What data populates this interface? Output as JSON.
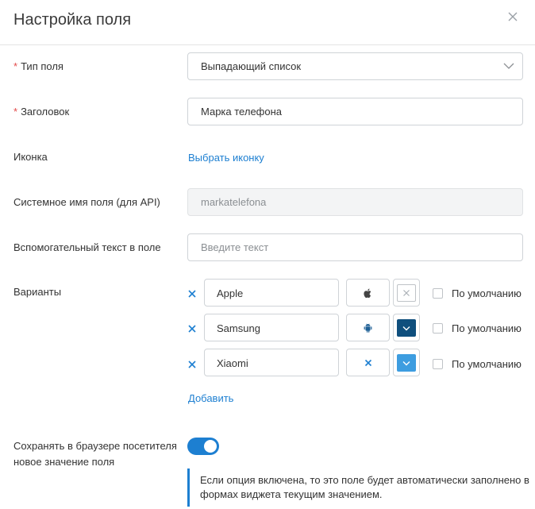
{
  "dialog": {
    "title": "Настройка поля",
    "close_icon": "close-icon"
  },
  "field_type": {
    "label": "Тип поля",
    "required": "*",
    "value": "Выпадающий список"
  },
  "heading": {
    "label": "Заголовок",
    "required": "*",
    "value": "Марка телефона"
  },
  "icon": {
    "label": "Иконка",
    "link": "Выбрать иконку"
  },
  "system_name": {
    "label": "Системное имя поля (для API)",
    "value": "markatelefona"
  },
  "helper_text": {
    "label": "Вспомогательный текст в поле",
    "placeholder": "Введите текст"
  },
  "variants": {
    "label": "Варианты",
    "add_label": "Добавить",
    "items": [
      {
        "value": "Apple",
        "icon": "apple-icon",
        "color": "none",
        "default_label": "По умолчанию",
        "default_checked": false
      },
      {
        "value": "Samsung",
        "icon": "android-icon",
        "color": "#0f4f7d",
        "default_label": "По умолчанию",
        "default_checked": false
      },
      {
        "value": "Xiaomi",
        "icon": "close-icon",
        "color": "#3d9de0",
        "default_label": "По умолчанию",
        "default_checked": false
      }
    ]
  },
  "save_in_browser": {
    "label_line1": "Сохранять в браузере посетителя",
    "label_line2": "новое значение поля",
    "enabled": true,
    "note": "Если опция включена, то это поле будет автоматически заполнено в формах виджета текущим значением."
  },
  "colors": {
    "accent": "#1d7fd1",
    "required": "#e34a4a",
    "swatch_dark": "#0f4f7d",
    "swatch_light": "#3d9de0"
  }
}
